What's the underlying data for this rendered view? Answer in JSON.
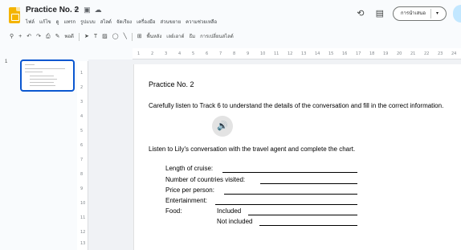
{
  "header": {
    "doc_title": "Practice No. 2",
    "menu": [
      "ไฟล์",
      "แก้ไข",
      "ดู",
      "แทรก",
      "รูปแบบ",
      "สไลด์",
      "จัดเรียง",
      "เครื่องมือ",
      "ส่วนขยาย",
      "ความช่วยเหลือ"
    ],
    "present_label": "การนำเสนอ"
  },
  "toolbar": {
    "zoom": "พอดี",
    "background_label": "พื้นหลัง",
    "layout_label": "เลย์เอาต์",
    "theme_label": "ธีม",
    "transition_label": "การเปลี่ยนสไลด์"
  },
  "filmstrip": {
    "slide_number": "1"
  },
  "ruler": {
    "h_ticks": [
      "1",
      "2",
      "3",
      "4",
      "5",
      "6",
      "7",
      "8",
      "9",
      "10",
      "11",
      "12",
      "13",
      "14",
      "15",
      "16",
      "17",
      "18",
      "19",
      "20",
      "21",
      "22",
      "23",
      "24"
    ],
    "v_ticks": [
      "1",
      "2",
      "3",
      "4",
      "5",
      "6",
      "7",
      "8",
      "9",
      "10",
      "11",
      "12",
      "13"
    ]
  },
  "slide": {
    "title": "Practice No. 2",
    "instruction": "Carefully listen to Track 6 to understand the details of the conversation and fill in the correct information.",
    "task": "Listen to Lily's conversation with the travel agent and complete the chart.",
    "fields": {
      "length": "Length of cruise:",
      "countries": "Number of countries visited:",
      "price": "Price per person:",
      "entertainment": "Entertainment:",
      "food": "Food:",
      "included": "Included",
      "not_included": "Not included"
    }
  },
  "colors": {
    "accent": "#0b57d0",
    "logo": "#f4b400",
    "share": "#c2e7ff"
  }
}
